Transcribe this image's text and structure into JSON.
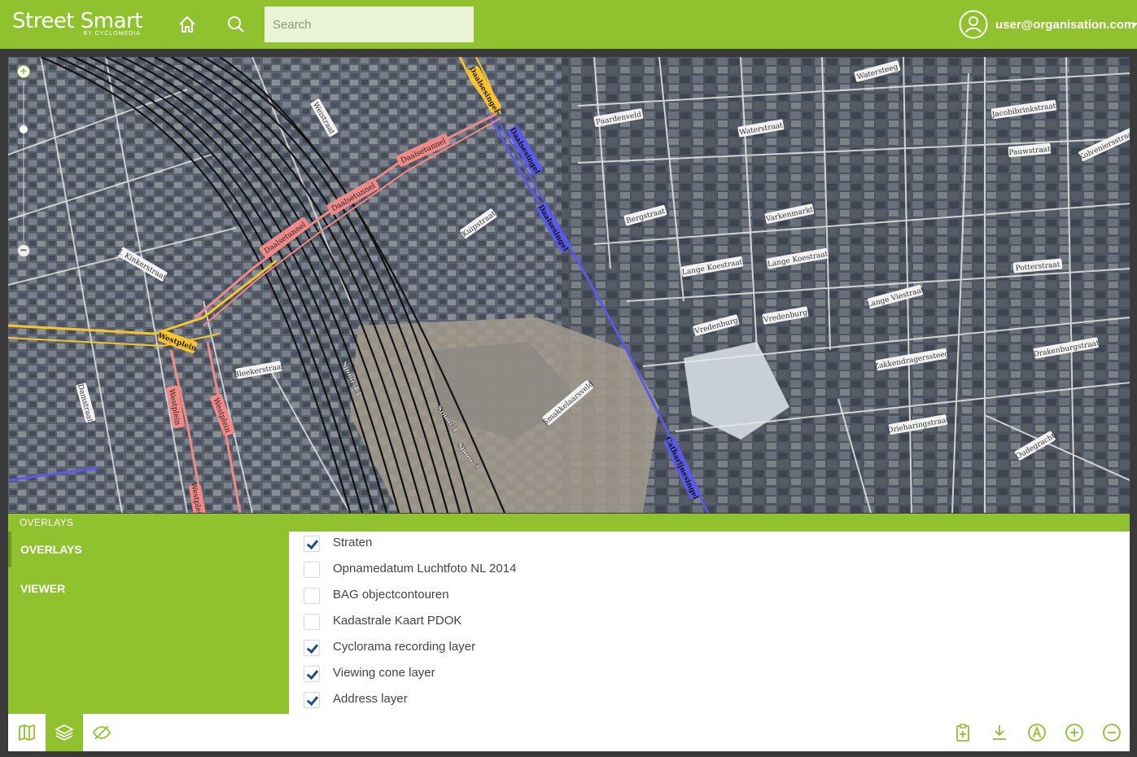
{
  "app": {
    "logo_main": "Street Smart",
    "logo_sub": "BY CYCLOMEDIA"
  },
  "header": {
    "search_placeholder": "Search",
    "user_email": "user@organisation.com"
  },
  "map": {
    "street_labels": [
      "Daalsesingel",
      "Daalsesingel",
      "Daalsesingel",
      "Daalsetunnel",
      "Daalsetunnel",
      "Daalsetunnel",
      "Westplein",
      "Westplein",
      "Westplein",
      "Westplein",
      "Spoor 13",
      "Spoor 1",
      "Spoor 2",
      "Catharijnesingel",
      "Vredenburg",
      "Vredenburg",
      "Lange Koestraat",
      "Lange Koestraat",
      "Varkenmarkt",
      "Watersteeg",
      "Waterstraat",
      "Paardenveld",
      "Bergstraat",
      "Kuipstraat",
      "Smakkelaarsveld",
      "Drakenburgstraat",
      "Zakkendragerssteeg",
      "Drieharingstraat",
      "Jacobibrinkstraat",
      "Pauwstraat",
      "Potterstraat",
      "Oudegracht",
      "Lange Viestraat",
      "Bleekerstraat",
      "Damstraat",
      "J. Kinkerstraat",
      "Weistraat",
      "Kolveniersstraat"
    ],
    "colors": {
      "daalsesingel": "#f7c430",
      "tunnel": "#f08a88",
      "catharijnesingel": "#5a5ae6",
      "rail": "#111111"
    }
  },
  "panel": {
    "title": "OVERLAYS",
    "nav": [
      {
        "label": "OVERLAYS",
        "active": true
      },
      {
        "label": "VIEWER",
        "active": false
      }
    ],
    "layers": [
      {
        "label": "Straten",
        "checked": true
      },
      {
        "label": "Opnamedatum Luchtfoto NL 2014",
        "checked": false
      },
      {
        "label": "BAG objectcontouren",
        "checked": false
      },
      {
        "label": "Kadastrale Kaart PDOK",
        "checked": false
      },
      {
        "label": "Cyclorama recording layer",
        "checked": true
      },
      {
        "label": "Viewing cone layer",
        "checked": true
      },
      {
        "label": "Address layer",
        "checked": true
      }
    ]
  },
  "toolbar": {
    "left": [
      "map-icon",
      "layers-icon",
      "eye-off-icon"
    ],
    "right": [
      "clipboard-plus-icon",
      "download-icon",
      "measure-icon",
      "zoom-in-icon",
      "zoom-out-icon"
    ]
  },
  "theme": {
    "accent": "#8fc22e",
    "checkmark": "#1c4f8a"
  }
}
